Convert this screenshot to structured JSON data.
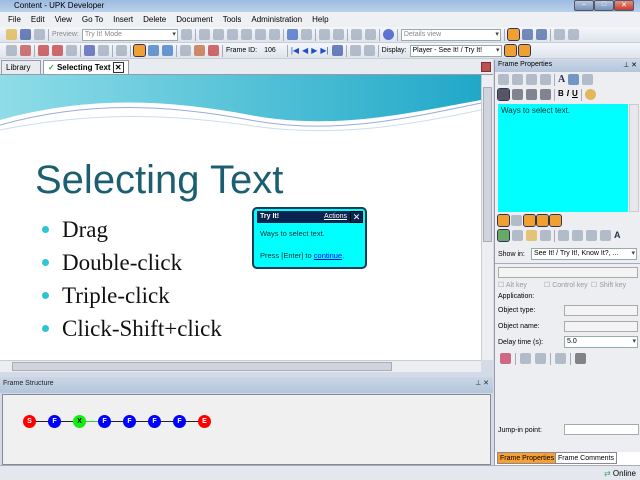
{
  "window": {
    "title": "Content - UPK Developer"
  },
  "menu": [
    "File",
    "Edit",
    "View",
    "Go To",
    "Insert",
    "Delete",
    "Document",
    "Tools",
    "Administration",
    "Help"
  ],
  "toolbar1": {
    "preview_label": "Preview:",
    "preview_mode": "Try It! Mode",
    "view_select": "Details view"
  },
  "toolbar2": {
    "frame_id_label": "Frame ID:",
    "frame_id": "106",
    "display_label": "Display:",
    "display_value": "Player - See It! / Try It!"
  },
  "tabs": [
    {
      "label": "Library"
    },
    {
      "label": "Selecting Text"
    }
  ],
  "slide": {
    "title": "Selecting Text",
    "bullets": [
      "Drag",
      "Double-click",
      "Triple-click",
      "Click-Shift+click"
    ]
  },
  "bubble": {
    "title": "Try It!",
    "actions": "Actions",
    "text": "Ways to select text.",
    "press": "Press [Enter] to ",
    "link": "continue",
    "period": "."
  },
  "frame_structure": {
    "title": "Frame Structure",
    "nodes": [
      "S",
      "F",
      "X",
      "F",
      "F",
      "F",
      "F",
      "E"
    ]
  },
  "frame_properties": {
    "title": "Frame Properties",
    "text": "Ways to select text.",
    "show_in_label": "Show in:",
    "show_in_value": "See It! / Try It!, Know It?, ...",
    "alt_key": "Alt key",
    "control_key": "Control key",
    "shift_key": "Shift key",
    "application_label": "Application:",
    "object_type_label": "Object type:",
    "object_name_label": "Object name:",
    "delay_label": "Delay time (s):",
    "delay_value": "5.0",
    "jump_in_label": "Jump-in point:",
    "tab_properties": "Frame Properties",
    "tab_comments": "Frame Comments"
  },
  "status": {
    "online": "Online"
  }
}
